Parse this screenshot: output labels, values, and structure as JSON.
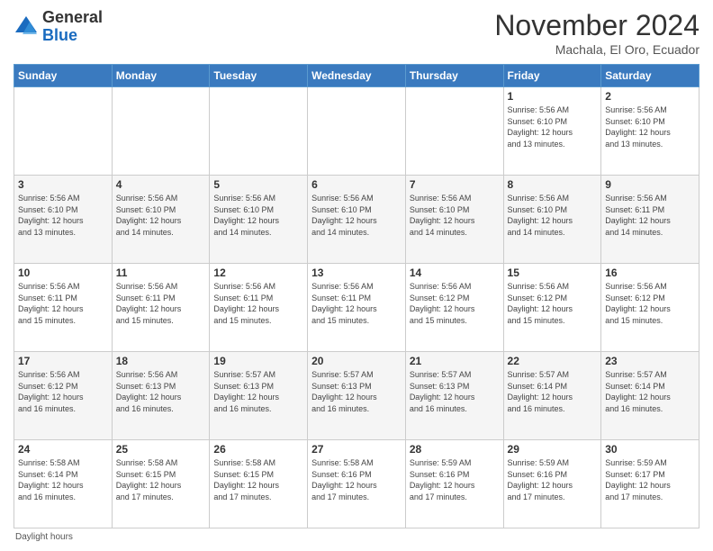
{
  "logo": {
    "general": "General",
    "blue": "Blue"
  },
  "header": {
    "month": "November 2024",
    "location": "Machala, El Oro, Ecuador"
  },
  "days_of_week": [
    "Sunday",
    "Monday",
    "Tuesday",
    "Wednesday",
    "Thursday",
    "Friday",
    "Saturday"
  ],
  "weeks": [
    [
      {
        "day": "",
        "info": ""
      },
      {
        "day": "",
        "info": ""
      },
      {
        "day": "",
        "info": ""
      },
      {
        "day": "",
        "info": ""
      },
      {
        "day": "",
        "info": ""
      },
      {
        "day": "1",
        "info": "Sunrise: 5:56 AM\nSunset: 6:10 PM\nDaylight: 12 hours\nand 13 minutes."
      },
      {
        "day": "2",
        "info": "Sunrise: 5:56 AM\nSunset: 6:10 PM\nDaylight: 12 hours\nand 13 minutes."
      }
    ],
    [
      {
        "day": "3",
        "info": "Sunrise: 5:56 AM\nSunset: 6:10 PM\nDaylight: 12 hours\nand 13 minutes."
      },
      {
        "day": "4",
        "info": "Sunrise: 5:56 AM\nSunset: 6:10 PM\nDaylight: 12 hours\nand 14 minutes."
      },
      {
        "day": "5",
        "info": "Sunrise: 5:56 AM\nSunset: 6:10 PM\nDaylight: 12 hours\nand 14 minutes."
      },
      {
        "day": "6",
        "info": "Sunrise: 5:56 AM\nSunset: 6:10 PM\nDaylight: 12 hours\nand 14 minutes."
      },
      {
        "day": "7",
        "info": "Sunrise: 5:56 AM\nSunset: 6:10 PM\nDaylight: 12 hours\nand 14 minutes."
      },
      {
        "day": "8",
        "info": "Sunrise: 5:56 AM\nSunset: 6:10 PM\nDaylight: 12 hours\nand 14 minutes."
      },
      {
        "day": "9",
        "info": "Sunrise: 5:56 AM\nSunset: 6:11 PM\nDaylight: 12 hours\nand 14 minutes."
      }
    ],
    [
      {
        "day": "10",
        "info": "Sunrise: 5:56 AM\nSunset: 6:11 PM\nDaylight: 12 hours\nand 15 minutes."
      },
      {
        "day": "11",
        "info": "Sunrise: 5:56 AM\nSunset: 6:11 PM\nDaylight: 12 hours\nand 15 minutes."
      },
      {
        "day": "12",
        "info": "Sunrise: 5:56 AM\nSunset: 6:11 PM\nDaylight: 12 hours\nand 15 minutes."
      },
      {
        "day": "13",
        "info": "Sunrise: 5:56 AM\nSunset: 6:11 PM\nDaylight: 12 hours\nand 15 minutes."
      },
      {
        "day": "14",
        "info": "Sunrise: 5:56 AM\nSunset: 6:12 PM\nDaylight: 12 hours\nand 15 minutes."
      },
      {
        "day": "15",
        "info": "Sunrise: 5:56 AM\nSunset: 6:12 PM\nDaylight: 12 hours\nand 15 minutes."
      },
      {
        "day": "16",
        "info": "Sunrise: 5:56 AM\nSunset: 6:12 PM\nDaylight: 12 hours\nand 15 minutes."
      }
    ],
    [
      {
        "day": "17",
        "info": "Sunrise: 5:56 AM\nSunset: 6:12 PM\nDaylight: 12 hours\nand 16 minutes."
      },
      {
        "day": "18",
        "info": "Sunrise: 5:56 AM\nSunset: 6:13 PM\nDaylight: 12 hours\nand 16 minutes."
      },
      {
        "day": "19",
        "info": "Sunrise: 5:57 AM\nSunset: 6:13 PM\nDaylight: 12 hours\nand 16 minutes."
      },
      {
        "day": "20",
        "info": "Sunrise: 5:57 AM\nSunset: 6:13 PM\nDaylight: 12 hours\nand 16 minutes."
      },
      {
        "day": "21",
        "info": "Sunrise: 5:57 AM\nSunset: 6:13 PM\nDaylight: 12 hours\nand 16 minutes."
      },
      {
        "day": "22",
        "info": "Sunrise: 5:57 AM\nSunset: 6:14 PM\nDaylight: 12 hours\nand 16 minutes."
      },
      {
        "day": "23",
        "info": "Sunrise: 5:57 AM\nSunset: 6:14 PM\nDaylight: 12 hours\nand 16 minutes."
      }
    ],
    [
      {
        "day": "24",
        "info": "Sunrise: 5:58 AM\nSunset: 6:14 PM\nDaylight: 12 hours\nand 16 minutes."
      },
      {
        "day": "25",
        "info": "Sunrise: 5:58 AM\nSunset: 6:15 PM\nDaylight: 12 hours\nand 17 minutes."
      },
      {
        "day": "26",
        "info": "Sunrise: 5:58 AM\nSunset: 6:15 PM\nDaylight: 12 hours\nand 17 minutes."
      },
      {
        "day": "27",
        "info": "Sunrise: 5:58 AM\nSunset: 6:16 PM\nDaylight: 12 hours\nand 17 minutes."
      },
      {
        "day": "28",
        "info": "Sunrise: 5:59 AM\nSunset: 6:16 PM\nDaylight: 12 hours\nand 17 minutes."
      },
      {
        "day": "29",
        "info": "Sunrise: 5:59 AM\nSunset: 6:16 PM\nDaylight: 12 hours\nand 17 minutes."
      },
      {
        "day": "30",
        "info": "Sunrise: 5:59 AM\nSunset: 6:17 PM\nDaylight: 12 hours\nand 17 minutes."
      }
    ]
  ],
  "footer": {
    "note": "Daylight hours"
  }
}
